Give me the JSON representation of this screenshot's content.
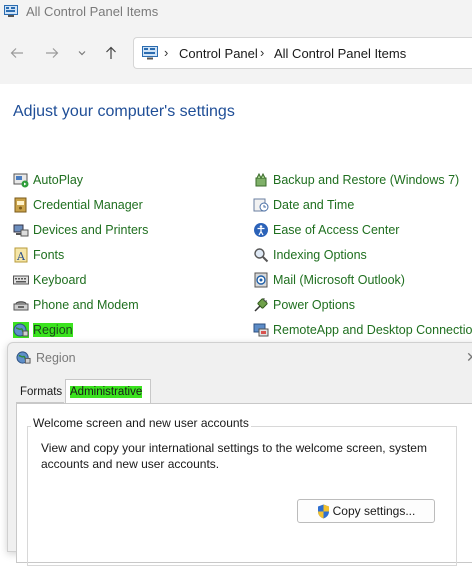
{
  "window": {
    "title": "All Control Panel Items"
  },
  "address": {
    "crumbs": [
      "Control Panel",
      "All Control Panel Items"
    ]
  },
  "heading": "Adjust your computer's settings",
  "items_left": [
    {
      "label": "AutoPlay",
      "icon": "autoplay-icon"
    },
    {
      "label": "Credential Manager",
      "icon": "credential-manager-icon"
    },
    {
      "label": "Devices and Printers",
      "icon": "devices-printers-icon"
    },
    {
      "label": "Fonts",
      "icon": "fonts-icon"
    },
    {
      "label": "Keyboard",
      "icon": "keyboard-icon"
    },
    {
      "label": "Phone and Modem",
      "icon": "phone-modem-icon"
    },
    {
      "label": "Region",
      "icon": "region-icon"
    }
  ],
  "items_right": [
    {
      "label": "Backup and Restore (Windows 7)",
      "icon": "backup-restore-icon"
    },
    {
      "label": "Date and Time",
      "icon": "date-time-icon"
    },
    {
      "label": "Ease of Access Center",
      "icon": "ease-of-access-icon"
    },
    {
      "label": "Indexing Options",
      "icon": "indexing-options-icon"
    },
    {
      "label": "Mail (Microsoft Outlook)",
      "icon": "mail-icon"
    },
    {
      "label": "Power Options",
      "icon": "power-options-icon"
    },
    {
      "label": "RemoteApp and Desktop Connections",
      "icon": "remoteapp-icon"
    }
  ],
  "dialog": {
    "title": "Region",
    "tabs": [
      "Formats",
      "Administrative"
    ],
    "group_title": "Welcome screen and new user accounts",
    "group_desc": "View and copy your international settings to the welcome screen, system accounts and new user accounts.",
    "copy_button": "Copy settings..."
  },
  "colors": {
    "highlight": "#3be31f",
    "link": "#1f6f1f",
    "heading": "#1f4e97"
  }
}
